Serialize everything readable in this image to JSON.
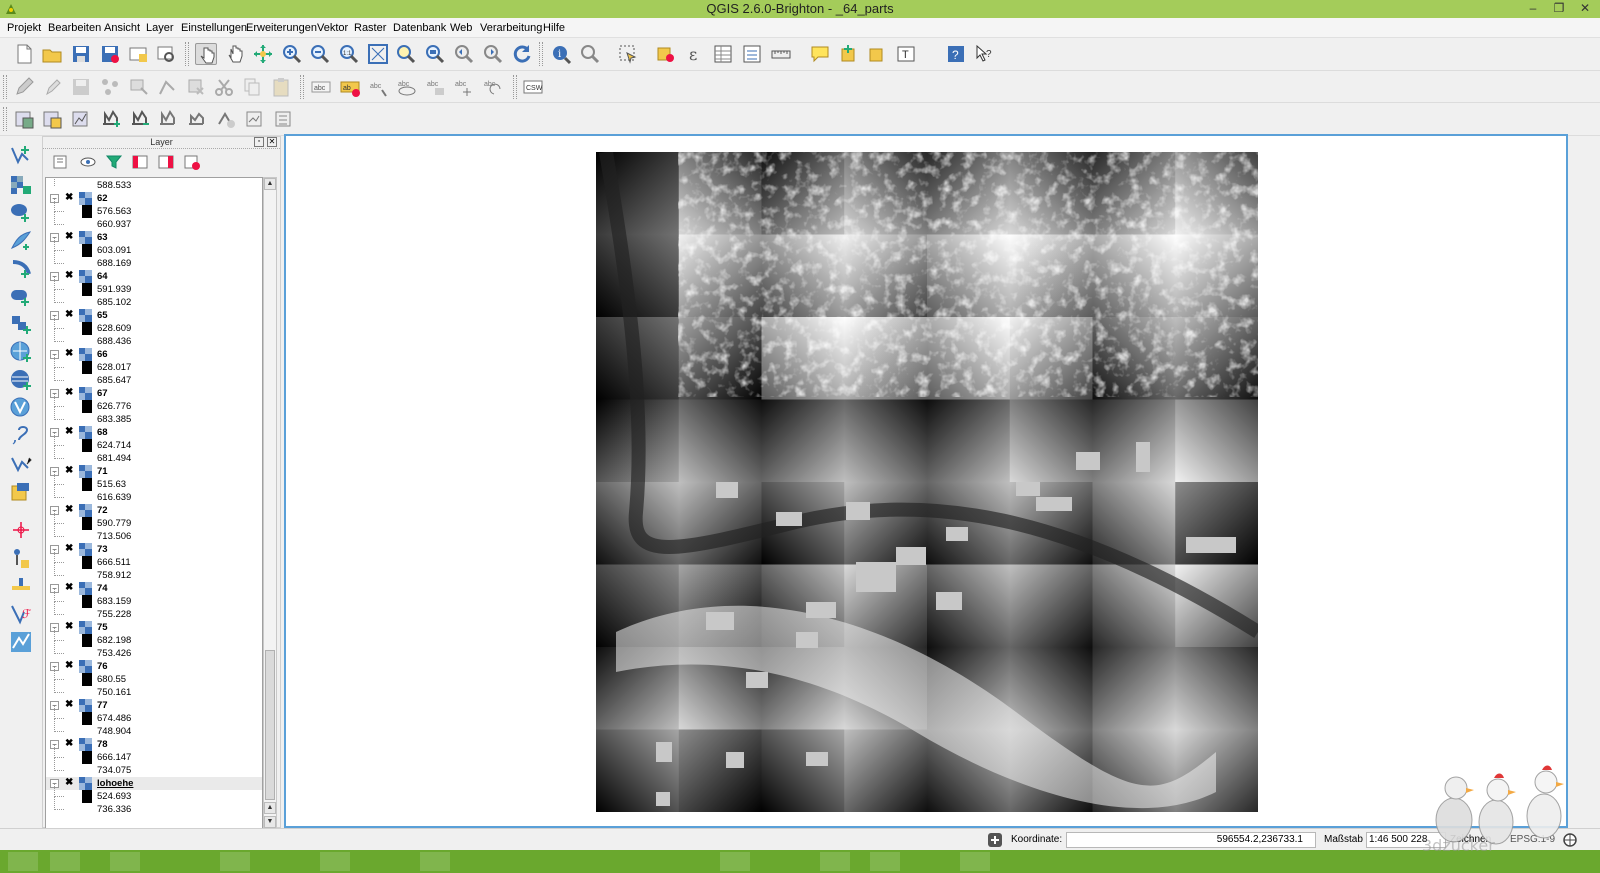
{
  "window": {
    "title": "QGIS 2.6.0-Brighton - _64_parts",
    "minimize": "–",
    "restore": "❐",
    "close": "✕"
  },
  "menu": [
    "Projekt",
    "Bearbeiten",
    "Ansicht",
    "Layer",
    "Einstellungen",
    "Erweiterungen",
    "Vektor",
    "Raster",
    "Datenbank",
    "Web",
    "Verarbeitung",
    "Hilfe"
  ],
  "toolbar2": {
    "csw_label": "CSW"
  },
  "layer_panel": {
    "title": "Layer",
    "float": "▫",
    "close": "✕",
    "scroll_up": "▲",
    "scroll_down": "▼",
    "collapse": "−",
    "check": "✖",
    "first_value": "588.533",
    "layers": [
      {
        "name": "62",
        "max": "576.563",
        "min": "660.937"
      },
      {
        "name": "63",
        "max": "603.091",
        "min": "688.169"
      },
      {
        "name": "64",
        "max": "591.939",
        "min": "685.102"
      },
      {
        "name": "65",
        "max": "628.609",
        "min": "688.436"
      },
      {
        "name": "66",
        "max": "628.017",
        "min": "685.647"
      },
      {
        "name": "67",
        "max": "626.776",
        "min": "683.385"
      },
      {
        "name": "68",
        "max": "624.714",
        "min": "681.494"
      },
      {
        "name": "71",
        "max": "515.63",
        "min": "616.639"
      },
      {
        "name": "72",
        "max": "590.779",
        "min": "713.506"
      },
      {
        "name": "73",
        "max": "666.511",
        "min": "758.912"
      },
      {
        "name": "74",
        "max": "683.159",
        "min": "755.228"
      },
      {
        "name": "75",
        "max": "682.198",
        "min": "753.426"
      },
      {
        "name": "76",
        "max": "680.55",
        "min": "750.161"
      },
      {
        "name": "77",
        "max": "674.486",
        "min": "748.904"
      },
      {
        "name": "78",
        "max": "666.147",
        "min": "734.075"
      },
      {
        "name": "lohoehe",
        "max": "524.693",
        "min": "736.336",
        "selected": true
      }
    ]
  },
  "status": {
    "coord_label": "Koordinate:",
    "coord_value": "596554.2,236733.1",
    "scale_label": "Maßstab",
    "scale_value": "1:46 500 228",
    "render_label": "Zeichnen",
    "crs_label": "EPSG:1-9"
  },
  "watermark": "3dzucker",
  "colors": {
    "titlebar": "#a4cc5a",
    "canvas_border": "#5aa0d8",
    "taskbar": "#6aa82e"
  }
}
